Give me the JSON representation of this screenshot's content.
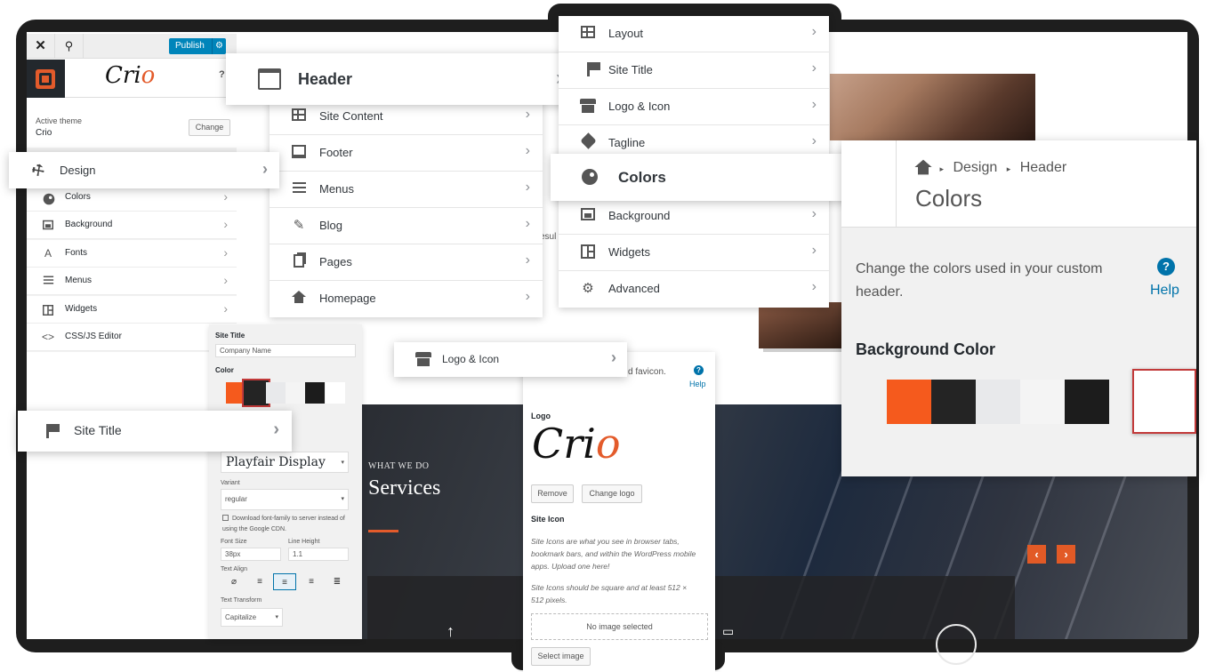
{
  "customizer": {
    "publish_label": "Publish",
    "logo_text": "Cri",
    "logo_o": "o",
    "help_mark": "?",
    "active_theme_label": "Active theme",
    "active_theme_name": "Crio",
    "change_label": "Change",
    "items": [
      {
        "label": "Colors",
        "icon": "palette-icon"
      },
      {
        "label": "Background",
        "icon": "image-icon"
      },
      {
        "label": "Fonts",
        "icon": "font-icon",
        "glyph": "A"
      },
      {
        "label": "Menus",
        "icon": "menu-icon"
      },
      {
        "label": "Widgets",
        "icon": "widgets-icon"
      },
      {
        "label": "CSS/JS Editor",
        "icon": "code-icon",
        "glyph": "<>"
      }
    ]
  },
  "design_card": {
    "label": "Design",
    "icon": "hammer-icon"
  },
  "header_card": {
    "label": "Header",
    "icon": "header-icon"
  },
  "mid_menu": {
    "items": [
      {
        "label": "Site Content",
        "icon": "grid-icon"
      },
      {
        "label": "Footer",
        "icon": "footer-icon"
      },
      {
        "label": "Menus",
        "icon": "menu-icon"
      },
      {
        "label": "Blog",
        "icon": "pin-icon"
      },
      {
        "label": "Pages",
        "icon": "pages-icon"
      },
      {
        "label": "Homepage",
        "icon": "home-icon"
      }
    ]
  },
  "right_menu": {
    "items": [
      {
        "label": "Layout",
        "icon": "layout-icon"
      },
      {
        "label": "Site Title",
        "icon": "flag-icon"
      },
      {
        "label": "Logo & Icon",
        "icon": "store-icon"
      },
      {
        "label": "Tagline",
        "icon": "tag-icon"
      },
      {
        "label": "Background",
        "icon": "image-icon"
      },
      {
        "label": "Widgets",
        "icon": "widgets-icon"
      },
      {
        "label": "Advanced",
        "icon": "gear-icon"
      }
    ]
  },
  "colors_card": {
    "label": "Colors",
    "icon": "palette-icon"
  },
  "colors_panel": {
    "crumb_1": "Design",
    "crumb_2": "Header",
    "title": "Colors",
    "description": "Change the colors used in your custom header.",
    "help_mark": "?",
    "help_label": "Help",
    "bg_label": "Background Color",
    "swatches": [
      "#f55a1d",
      "#242424",
      "#e8e9eb",
      "#f4f4f4",
      "#1c1c1c",
      "#ffffff"
    ],
    "selected_swatch": 5
  },
  "site_title_form": {
    "section_label": "Site Title",
    "input_value": "Company Name",
    "color_label": "Color",
    "font_family": "Playfair Display",
    "variant_label": "Variant",
    "variant_value": "regular",
    "download_label": "Download font-family to server instead of using the Google CDN.",
    "font_size_label": "Font Size",
    "font_size_value": "38px",
    "line_height_label": "Line Height",
    "line_height_value": "1.1",
    "text_align_label": "Text Align",
    "text_transform_label": "Text Transform",
    "text_transform_value": "Capitalize"
  },
  "site_title_card": {
    "label": "Site Title",
    "icon": "flag-icon"
  },
  "logo_icon_card": {
    "label": "Logo & Icon",
    "icon": "store-icon"
  },
  "logo_panel": {
    "snippet": "d favicon.",
    "help_mark": "?",
    "help_label": "Help",
    "logo_label": "Logo",
    "logo_text": "Cri",
    "logo_o": "o",
    "remove_label": "Remove",
    "change_logo_label": "Change logo",
    "site_icon_label": "Site Icon",
    "site_icon_desc": "Site Icons are what you see in browser tabs, bookmark bars, and within the WordPress mobile apps. Upload one here!",
    "site_icon_size": "Site Icons should be square and at least 512 × 512 pixels.",
    "no_image": "No image selected",
    "select_image": "Select image"
  },
  "website": {
    "what_we_do": "WHAT WE DO",
    "services": "Services",
    "snippet_1": "s",
    "snippet_2": "esul",
    "prev_arrow": "‹",
    "next_arrow": "›"
  },
  "colors": {
    "accent": "#e35b2b",
    "primary": "#0085ba",
    "link": "#0073aa"
  }
}
